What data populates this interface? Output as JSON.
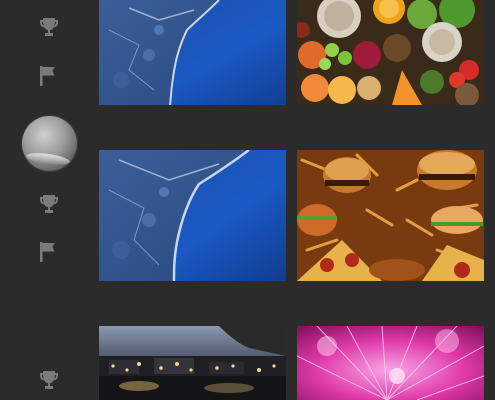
{
  "sidebar": {
    "icons": [
      {
        "name": "trophy-icon"
      },
      {
        "name": "flag-icon"
      },
      {
        "name": "avatar"
      },
      {
        "name": "trophy-icon"
      },
      {
        "name": "flag-icon"
      },
      {
        "name": "trophy-icon"
      }
    ],
    "icon_color": "#7a7a7a"
  },
  "feed": {
    "rows": [
      {
        "left": "coastline-aerial-photo",
        "right": "fruits-vegetables-photo"
      },
      {
        "left": "coastline-aerial-photo",
        "right": "fast-food-photo"
      },
      {
        "left": "city-night-photo",
        "right": "pink-dandelion-photo"
      }
    ]
  },
  "colors": {
    "background": "#2b2b2b",
    "icon": "#7a7a7a"
  }
}
